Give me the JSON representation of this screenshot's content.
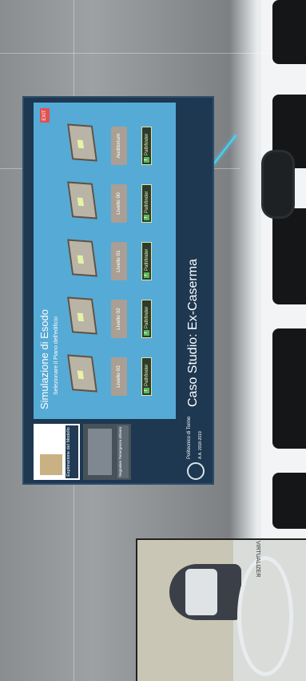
{
  "panel": {
    "title": "Simulazione di Esodo",
    "subtitle": "Selezionare il Piano dell'edificio",
    "exit_label": "EXIT",
    "case_study": "Caso Studio: Ex-Caserma",
    "university": "Politecnico di Torino",
    "academic_year": "A.A. 2018-2019"
  },
  "sidebar": {
    "explore_label": "Esplorazione del Modello",
    "report_label": "Segnalare l'emergenza attivata"
  },
  "levels": [
    {
      "label": "Livello 03",
      "pathfinder": "Pathfinder"
    },
    {
      "label": "Livello 02",
      "pathfinder": "Pathfinder"
    },
    {
      "label": "Livello 01",
      "pathfinder": "Pathfinder"
    },
    {
      "label": "Livello 00",
      "pathfinder": "Pathfinder"
    },
    {
      "label": "Auditorium",
      "pathfinder": "Pathfinder"
    }
  ],
  "inset": {
    "brand": "VIRTUALIZER"
  },
  "colors": {
    "panel_bg": "#1d3850",
    "main_bg": "#56aad6",
    "level_btn": "#a99f94",
    "exit_btn": "#e0524f",
    "laser": "#3fd7ff"
  }
}
